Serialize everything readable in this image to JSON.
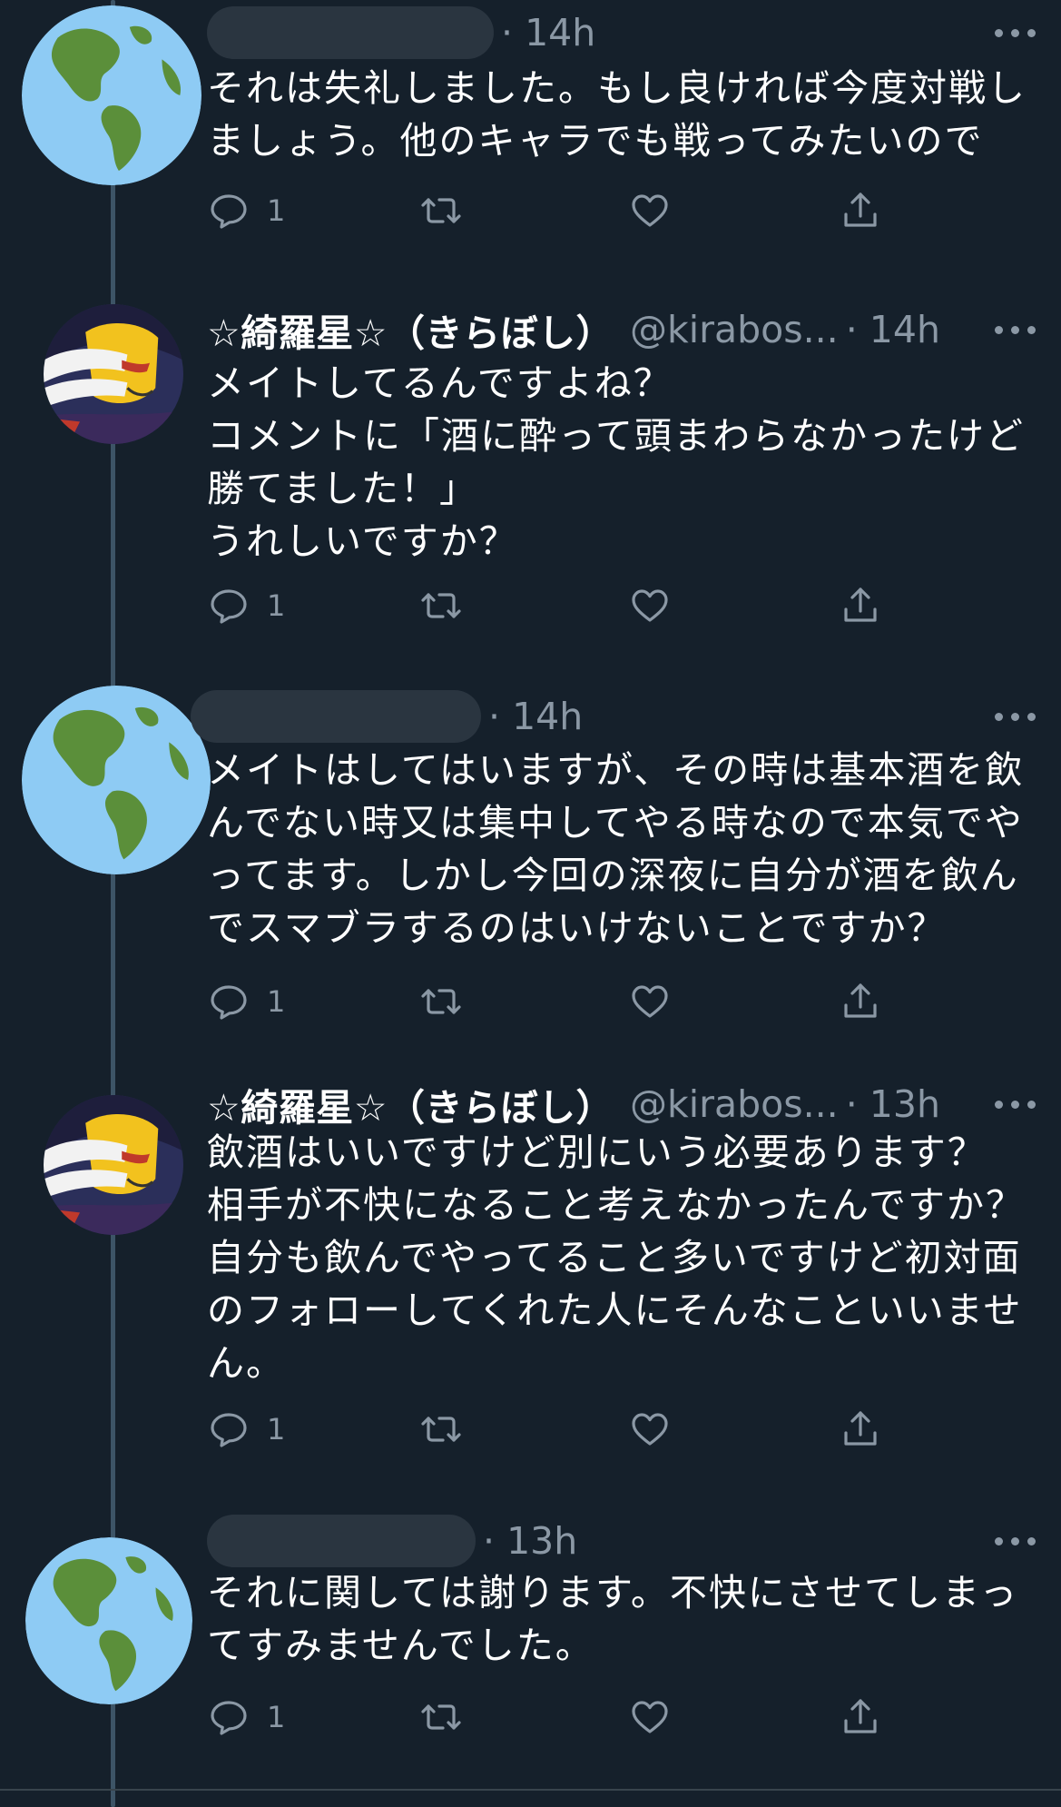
{
  "tweets": [
    {
      "author": "",
      "handle": "",
      "time": "· 14h",
      "lines": [
        "それは失礼しました。もし良ければ今度対戦し",
        "ましょう。他のキャラでも戦ってみたいので"
      ],
      "reply_count": "1",
      "avatar_icon": "globe-icon"
    },
    {
      "author": "☆綺羅星☆（きらぼし）",
      "handle": "@kirabos...",
      "time": "· 14h",
      "lines": [
        "メイトしてるんですよね？",
        "コメントに「酒に酔って頭まわらなかったけど",
        "勝てました！」",
        "うれしいですか？"
      ],
      "reply_count": "1",
      "avatar_icon": "anime-character-avatar"
    },
    {
      "author": "",
      "handle": "",
      "time": "· 14h",
      "lines": [
        "メイトはしてはいますが、その時は基本酒を飲",
        "んでない時又は集中してやる時なので本気でや",
        "ってます。しかし今回の深夜に自分が酒を飲ん",
        "でスマブラするのはいけないことですか？"
      ],
      "reply_count": "1",
      "avatar_icon": "globe-icon"
    },
    {
      "author": "☆綺羅星☆（きらぼし）",
      "handle": "@kirabos...",
      "time": "· 13h",
      "lines": [
        "飲酒はいいですけど別にいう必要あります？",
        "相手が不快になること考えなかったんですか？",
        "自分も飲んでやってること多いですけど初対面",
        "のフォローしてくれた人にそんなこといいませ",
        "ん。"
      ],
      "reply_count": "1",
      "avatar_icon": "anime-character-avatar"
    },
    {
      "author": "",
      "handle": "",
      "time": "· 13h",
      "lines": [
        "それに関しては謝ります。不快にさせてしまっ",
        "てすみませんでした。"
      ],
      "reply_count": "1",
      "avatar_icon": "globe-icon"
    }
  ],
  "icons": {
    "reply": "reply-icon",
    "retweet": "retweet-icon",
    "like": "heart-icon",
    "share": "share-icon",
    "more": "more-icon"
  },
  "colors": {
    "background": "#15202b",
    "secondary_text": "#8b98a5",
    "thread_line": "#3d5466",
    "globe_ocean": "#8ecbf4",
    "globe_land": "#5b8f3a"
  }
}
